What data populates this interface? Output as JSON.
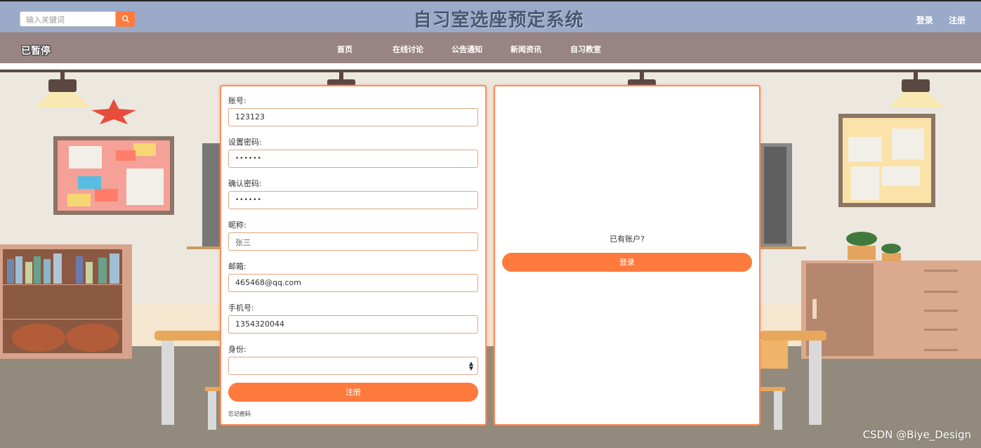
{
  "header": {
    "search_placeholder": "输入关键词",
    "title": "自习室选座预定系统",
    "login": "登录",
    "register": "注册"
  },
  "nav": {
    "status": "已暂停",
    "items": [
      "首页",
      "在线讨论",
      "公告通知",
      "新闻资讯",
      "自习教室"
    ]
  },
  "form": {
    "account_label": "账号:",
    "account_value": "123123",
    "password_label": "设置密码:",
    "password_value": "••••••",
    "confirm_label": "确认密码:",
    "confirm_value": "••••••",
    "nickname_label": "昵称:",
    "nickname_value": "张三",
    "email_label": "邮箱:",
    "email_value": "465468@qq.com",
    "phone_label": "手机号:",
    "phone_value": "1354320044",
    "role_label": "身份:",
    "role_value": "",
    "submit": "注册",
    "forgot": "忘记密码"
  },
  "side": {
    "prompt": "已有账户?",
    "login_button": "登录"
  },
  "watermark": "CSDN @Biye_Design",
  "colors": {
    "accent": "#ff7a3d",
    "topbar": "#9aaac8",
    "navbar": "#988482"
  }
}
